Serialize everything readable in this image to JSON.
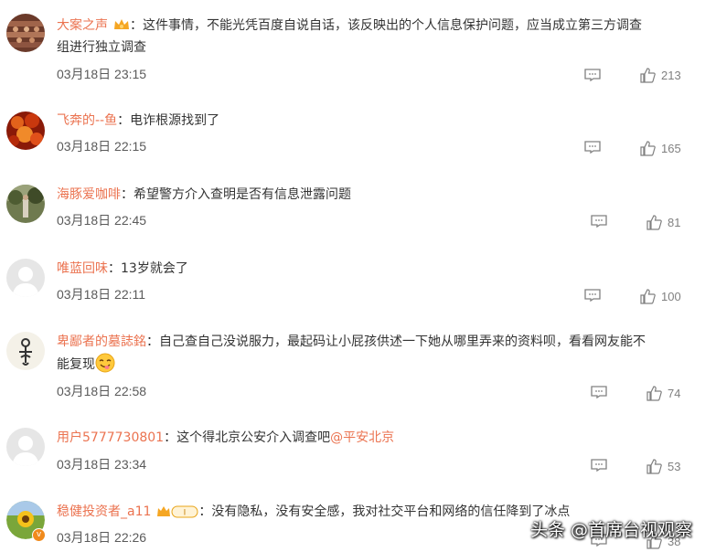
{
  "comments": [
    {
      "username": "大案之声",
      "sep": "：",
      "text": "这件事情，不能光凭百度自说自话，该反映出的个人信息保护问题，应当成立第三方调查",
      "text2": "组进行独立调查",
      "time": "03月18日 23:15",
      "likes": "213",
      "avatar": "shelf-photo"
    },
    {
      "username": "飞奔的--鱼",
      "sep": "：",
      "text": "电诈根源找到了",
      "time": "03月18日 22:15",
      "likes": "165",
      "avatar": "red-leaves-photo"
    },
    {
      "username": "海豚爱咖啡",
      "sep": "：",
      "text": "希望警方介入查明是否有信息泄露问题",
      "time": "03月18日 22:45",
      "likes": "81",
      "avatar": "garden-photo"
    },
    {
      "username": "唯蓝回味",
      "sep": "：",
      "text": "13岁就会了",
      "time": "03月18日 22:11",
      "likes": "100",
      "avatar": "default-avatar"
    },
    {
      "username": "卑鄙者的墓誌銘",
      "sep": "：",
      "text": "自己查自己没说服力，最起码让小屁孩供述一下她从哪里弄来的资料呗，看看网友能不",
      "text2": "能复现",
      "time": "03月18日 22:58",
      "likes": "74",
      "avatar": "symbol-avatar"
    },
    {
      "username": "用户5777730801",
      "sep": "：",
      "text": "这个得北京公安介入调查吧",
      "mention": "@平安北京",
      "time": "03月18日 23:34",
      "likes": "53",
      "avatar": "default-avatar"
    },
    {
      "username": "稳健投资者_a11",
      "sep": "：",
      "text": "没有隐私，没有安全感，我对社交平台和网络的信任降到了冰点",
      "time": "03月18日 22:26",
      "likes": "38",
      "avatar": "sunflower-photo"
    }
  ],
  "watermark": "头条 @首席台视观察",
  "colors": {
    "username": "#eb7350",
    "text": "#333333",
    "time": "#5a5a5a",
    "icon": "#808080"
  }
}
